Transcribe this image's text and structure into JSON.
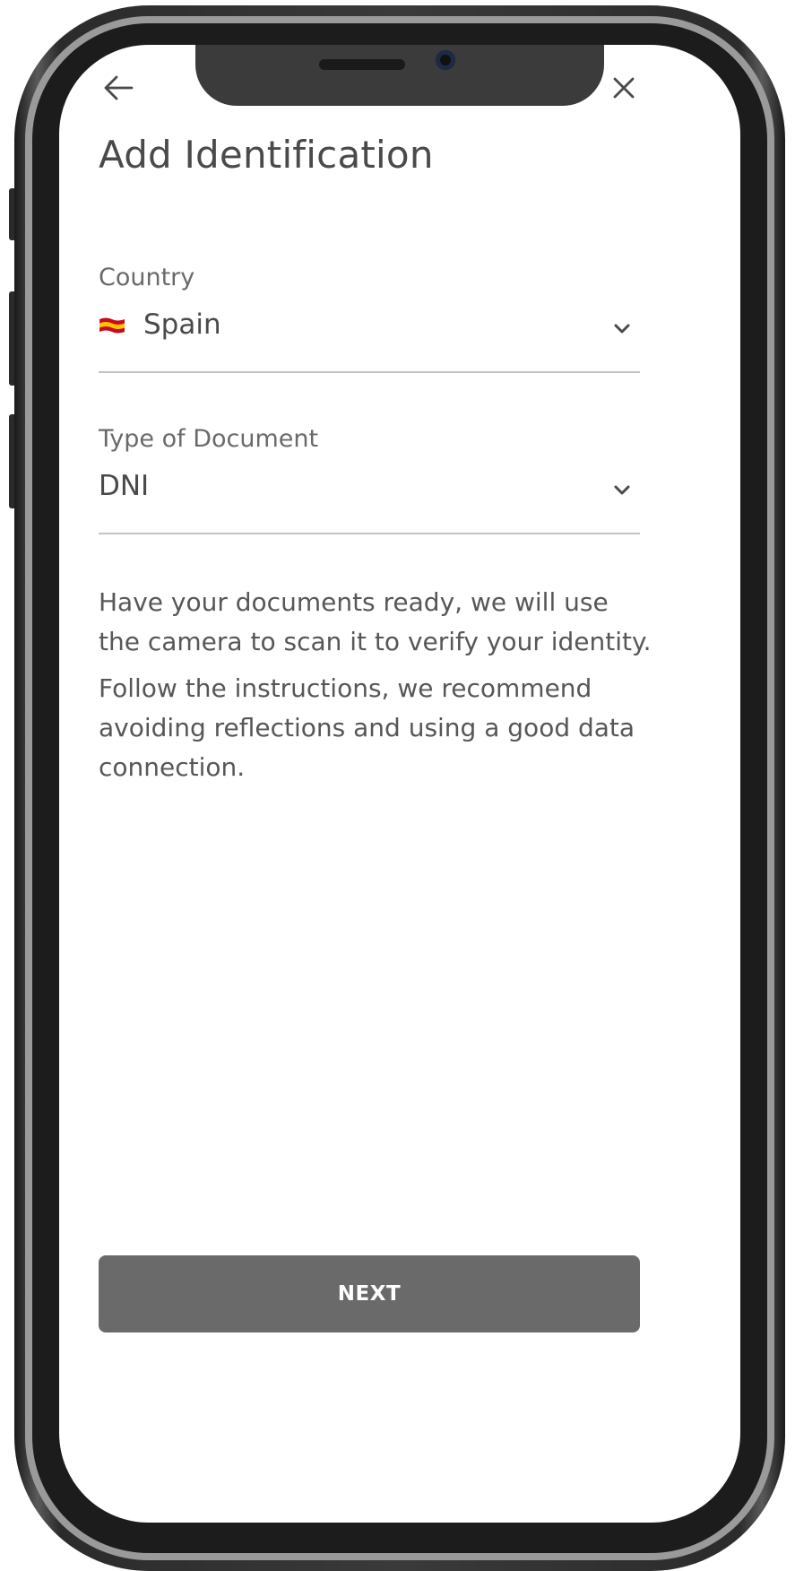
{
  "header": {
    "back_icon": "arrow-left-icon",
    "close_icon": "close-icon",
    "title": "Add Identification"
  },
  "form": {
    "country": {
      "label": "Country",
      "value": "Spain",
      "flag_icon": "spain-flag-icon",
      "chevron_icon": "chevron-down-icon"
    },
    "document_type": {
      "label": "Type of Document",
      "value": "DNI",
      "chevron_icon": "chevron-down-icon"
    }
  },
  "instructions": {
    "paragraph_1": "Have your documents ready, we will use the camera to scan it to verify your identity.",
    "paragraph_2": "Follow the instructions, we recommend avoiding reflections and using a good data connection."
  },
  "actions": {
    "next_label": "NEXT"
  },
  "colors": {
    "button_bg": "#6a6a6b",
    "text_primary": "#4a4a4a",
    "divider": "#c4c4c4"
  }
}
